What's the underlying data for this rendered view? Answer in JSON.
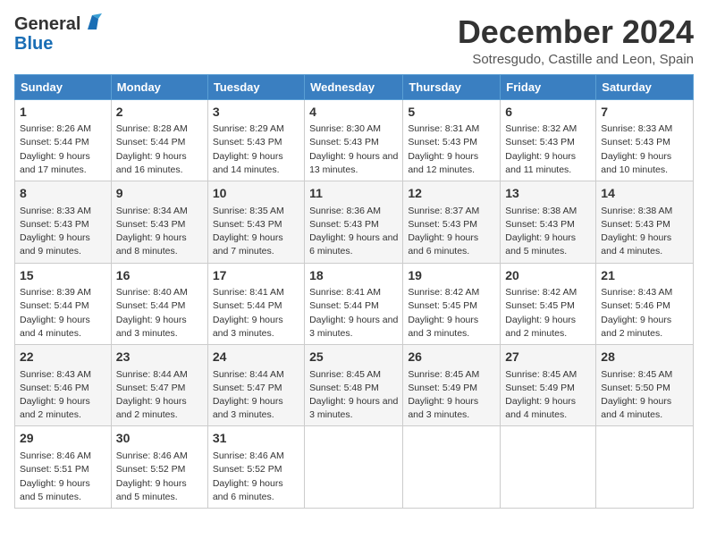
{
  "header": {
    "logo_general": "General",
    "logo_blue": "Blue",
    "month_title": "December 2024",
    "location": "Sotresgudo, Castille and Leon, Spain"
  },
  "columns": [
    "Sunday",
    "Monday",
    "Tuesday",
    "Wednesday",
    "Thursday",
    "Friday",
    "Saturday"
  ],
  "weeks": [
    [
      {
        "day": "1",
        "sunrise": "8:26 AM",
        "sunset": "5:44 PM",
        "daylight": "9 hours and 17 minutes."
      },
      {
        "day": "2",
        "sunrise": "8:28 AM",
        "sunset": "5:44 PM",
        "daylight": "9 hours and 16 minutes."
      },
      {
        "day": "3",
        "sunrise": "8:29 AM",
        "sunset": "5:43 PM",
        "daylight": "9 hours and 14 minutes."
      },
      {
        "day": "4",
        "sunrise": "8:30 AM",
        "sunset": "5:43 PM",
        "daylight": "9 hours and 13 minutes."
      },
      {
        "day": "5",
        "sunrise": "8:31 AM",
        "sunset": "5:43 PM",
        "daylight": "9 hours and 12 minutes."
      },
      {
        "day": "6",
        "sunrise": "8:32 AM",
        "sunset": "5:43 PM",
        "daylight": "9 hours and 11 minutes."
      },
      {
        "day": "7",
        "sunrise": "8:33 AM",
        "sunset": "5:43 PM",
        "daylight": "9 hours and 10 minutes."
      }
    ],
    [
      {
        "day": "8",
        "sunrise": "8:33 AM",
        "sunset": "5:43 PM",
        "daylight": "9 hours and 9 minutes."
      },
      {
        "day": "9",
        "sunrise": "8:34 AM",
        "sunset": "5:43 PM",
        "daylight": "9 hours and 8 minutes."
      },
      {
        "day": "10",
        "sunrise": "8:35 AM",
        "sunset": "5:43 PM",
        "daylight": "9 hours and 7 minutes."
      },
      {
        "day": "11",
        "sunrise": "8:36 AM",
        "sunset": "5:43 PM",
        "daylight": "9 hours and 6 minutes."
      },
      {
        "day": "12",
        "sunrise": "8:37 AM",
        "sunset": "5:43 PM",
        "daylight": "9 hours and 6 minutes."
      },
      {
        "day": "13",
        "sunrise": "8:38 AM",
        "sunset": "5:43 PM",
        "daylight": "9 hours and 5 minutes."
      },
      {
        "day": "14",
        "sunrise": "8:38 AM",
        "sunset": "5:43 PM",
        "daylight": "9 hours and 4 minutes."
      }
    ],
    [
      {
        "day": "15",
        "sunrise": "8:39 AM",
        "sunset": "5:44 PM",
        "daylight": "9 hours and 4 minutes."
      },
      {
        "day": "16",
        "sunrise": "8:40 AM",
        "sunset": "5:44 PM",
        "daylight": "9 hours and 3 minutes."
      },
      {
        "day": "17",
        "sunrise": "8:41 AM",
        "sunset": "5:44 PM",
        "daylight": "9 hours and 3 minutes."
      },
      {
        "day": "18",
        "sunrise": "8:41 AM",
        "sunset": "5:44 PM",
        "daylight": "9 hours and 3 minutes."
      },
      {
        "day": "19",
        "sunrise": "8:42 AM",
        "sunset": "5:45 PM",
        "daylight": "9 hours and 3 minutes."
      },
      {
        "day": "20",
        "sunrise": "8:42 AM",
        "sunset": "5:45 PM",
        "daylight": "9 hours and 2 minutes."
      },
      {
        "day": "21",
        "sunrise": "8:43 AM",
        "sunset": "5:46 PM",
        "daylight": "9 hours and 2 minutes."
      }
    ],
    [
      {
        "day": "22",
        "sunrise": "8:43 AM",
        "sunset": "5:46 PM",
        "daylight": "9 hours and 2 minutes."
      },
      {
        "day": "23",
        "sunrise": "8:44 AM",
        "sunset": "5:47 PM",
        "daylight": "9 hours and 2 minutes."
      },
      {
        "day": "24",
        "sunrise": "8:44 AM",
        "sunset": "5:47 PM",
        "daylight": "9 hours and 3 minutes."
      },
      {
        "day": "25",
        "sunrise": "8:45 AM",
        "sunset": "5:48 PM",
        "daylight": "9 hours and 3 minutes."
      },
      {
        "day": "26",
        "sunrise": "8:45 AM",
        "sunset": "5:49 PM",
        "daylight": "9 hours and 3 minutes."
      },
      {
        "day": "27",
        "sunrise": "8:45 AM",
        "sunset": "5:49 PM",
        "daylight": "9 hours and 4 minutes."
      },
      {
        "day": "28",
        "sunrise": "8:45 AM",
        "sunset": "5:50 PM",
        "daylight": "9 hours and 4 minutes."
      }
    ],
    [
      {
        "day": "29",
        "sunrise": "8:46 AM",
        "sunset": "5:51 PM",
        "daylight": "9 hours and 5 minutes."
      },
      {
        "day": "30",
        "sunrise": "8:46 AM",
        "sunset": "5:52 PM",
        "daylight": "9 hours and 5 minutes."
      },
      {
        "day": "31",
        "sunrise": "8:46 AM",
        "sunset": "5:52 PM",
        "daylight": "9 hours and 6 minutes."
      },
      null,
      null,
      null,
      null
    ]
  ],
  "labels": {
    "sunrise": "Sunrise:",
    "sunset": "Sunset:",
    "daylight": "Daylight:"
  }
}
